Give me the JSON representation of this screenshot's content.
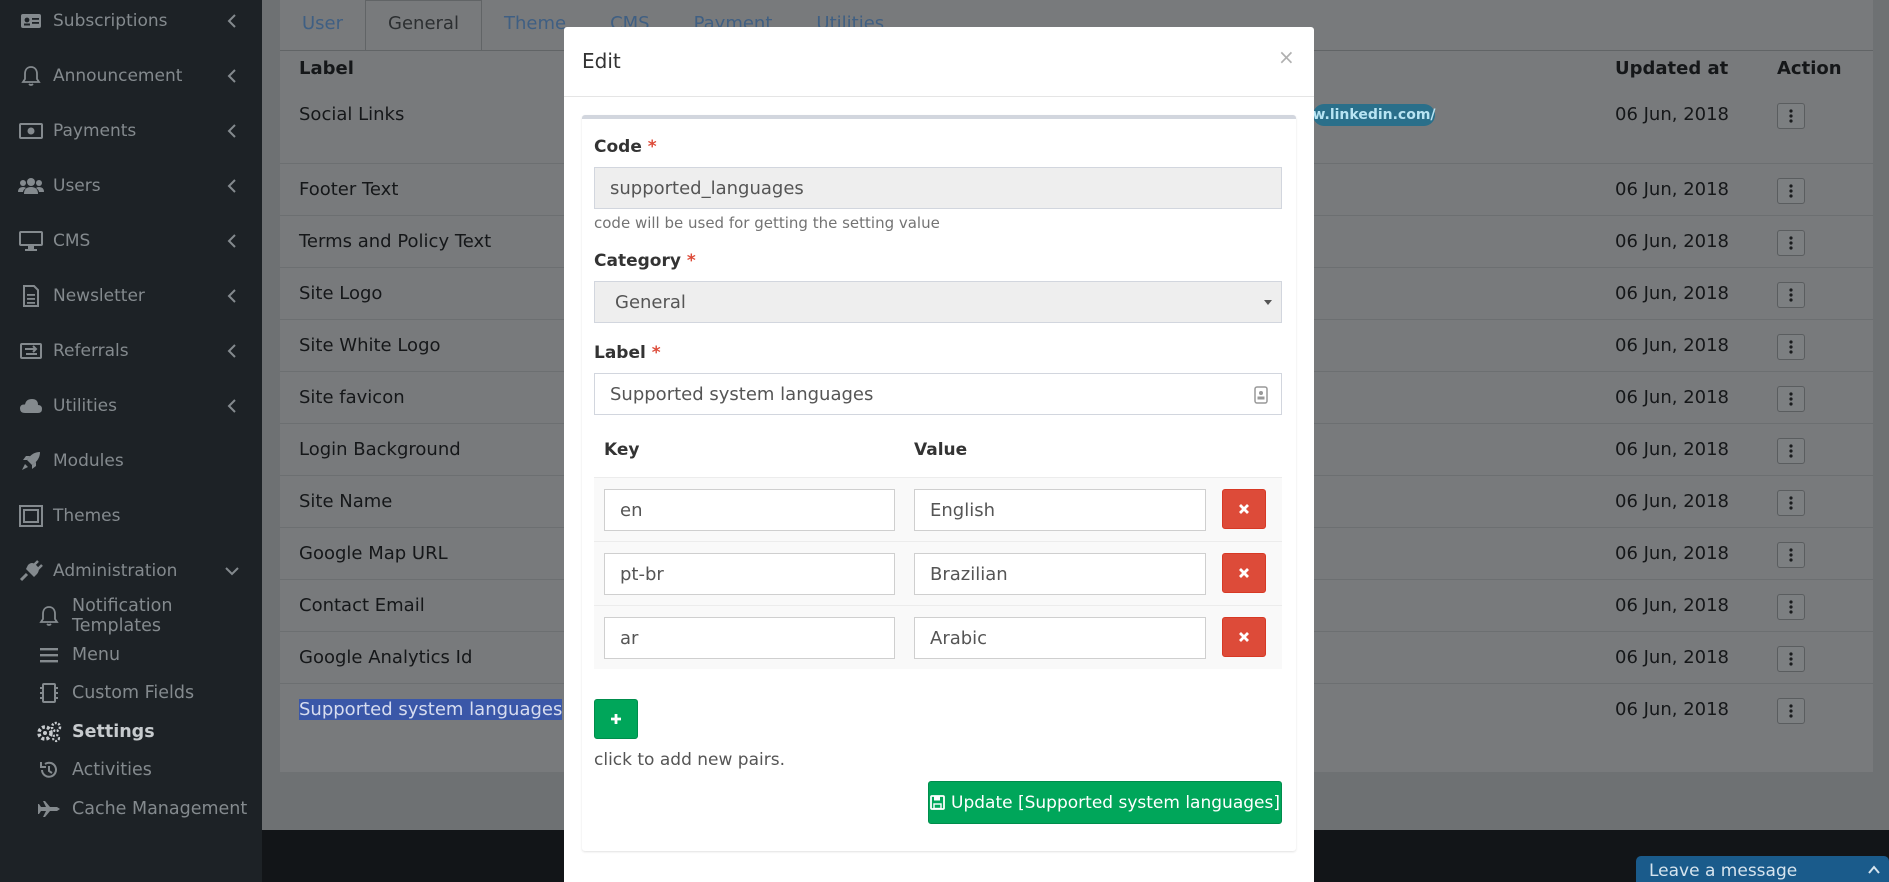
{
  "sidebar": {
    "items": [
      {
        "label": "Subscriptions",
        "icon": "id-card-icon"
      },
      {
        "label": "Announcement",
        "icon": "bell-icon"
      },
      {
        "label": "Payments",
        "icon": "money-icon"
      },
      {
        "label": "Users",
        "icon": "users-icon"
      },
      {
        "label": "CMS",
        "icon": "desktop-icon"
      },
      {
        "label": "Newsletter",
        "icon": "document-icon"
      },
      {
        "label": "Referrals",
        "icon": "exchange-icon"
      },
      {
        "label": "Utilities",
        "icon": "cloud-icon"
      },
      {
        "label": "Modules",
        "icon": "rocket-icon"
      },
      {
        "label": "Themes",
        "icon": "theme-icon"
      },
      {
        "label": "Administration",
        "icon": "plug-icon"
      }
    ],
    "admin_items": [
      {
        "label": "Notification Templates",
        "icon": "bell-icon"
      },
      {
        "label": "Menu",
        "icon": "bars-icon"
      },
      {
        "label": "Custom Fields",
        "icon": "chip-icon"
      },
      {
        "label": "Settings",
        "icon": "gears-icon"
      },
      {
        "label": "Activities",
        "icon": "history-icon"
      },
      {
        "label": "Cache Management",
        "icon": "plane-icon"
      }
    ]
  },
  "tabs": [
    "User",
    "General",
    "Theme",
    "CMS",
    "Payment",
    "Utilities"
  ],
  "table": {
    "headers": {
      "label": "Label",
      "updated_at": "Updated at",
      "action": "Action"
    },
    "linkedin_pill": "w.linkedin.com/",
    "rows": [
      {
        "label": "Social Links",
        "updated": "06 Jun, 2018"
      },
      {
        "label": "Footer Text",
        "updated": "06 Jun, 2018"
      },
      {
        "label": "Terms and Policy Text",
        "updated": "06 Jun, 2018"
      },
      {
        "label": "Site Logo",
        "updated": "06 Jun, 2018"
      },
      {
        "label": "Site White Logo",
        "updated": "06 Jun, 2018"
      },
      {
        "label": "Site favicon",
        "updated": "06 Jun, 2018"
      },
      {
        "label": "Login Background",
        "updated": "06 Jun, 2018"
      },
      {
        "label": "Site Name",
        "updated": "06 Jun, 2018"
      },
      {
        "label": "Google Map URL",
        "updated": "06 Jun, 2018"
      },
      {
        "label": "Contact Email",
        "updated": "06 Jun, 2018"
      },
      {
        "label": "Google Analytics Id",
        "updated": "06 Jun, 2018"
      },
      {
        "label": "Supported system languages",
        "updated": "06 Jun, 2018"
      }
    ]
  },
  "modal": {
    "title": "Edit",
    "close": "×",
    "code_label": "Code",
    "code_value": "supported_languages",
    "code_help": "code will be used for getting the setting value",
    "category_label": "Category",
    "category_value": "General",
    "label_label": "Label",
    "label_value": "Supported system languages",
    "required_mark": "*",
    "kv_key_header": "Key",
    "kv_value_header": "Value",
    "pairs": [
      {
        "key": "en",
        "value": "English"
      },
      {
        "key": "pt-br",
        "value": "Brazilian"
      },
      {
        "key": "ar",
        "value": "Arabic"
      }
    ],
    "add_help": "click to add new pairs.",
    "update_button": "Update [Supported system languages]"
  },
  "chat_widget": {
    "label": "Leave a message"
  },
  "colors": {
    "accent_green": "#00a65a",
    "danger_red": "#dd4b39",
    "sidebar_bg": "#1d2226"
  }
}
